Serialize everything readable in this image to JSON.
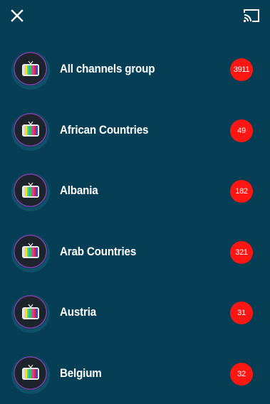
{
  "toolbar": {
    "close_icon": "close-icon",
    "cast_icon": "cast-icon"
  },
  "groups": [
    {
      "label": "All channels group",
      "count": "3911",
      "icon": "tv-icon"
    },
    {
      "label": "African Countries",
      "count": "49",
      "icon": "tv-icon"
    },
    {
      "label": "Albania",
      "count": "182",
      "icon": "tv-icon"
    },
    {
      "label": "Arab Countries",
      "count": "321",
      "icon": "tv-icon"
    },
    {
      "label": "Austria",
      "count": "31",
      "icon": "tv-icon"
    },
    {
      "label": "Belgium",
      "count": "32",
      "icon": "tv-icon"
    }
  ],
  "colors": {
    "background": "#053e55",
    "badge": "#ff1612",
    "text": "#ffffff",
    "avatar_ring": "#7b3fa8"
  }
}
